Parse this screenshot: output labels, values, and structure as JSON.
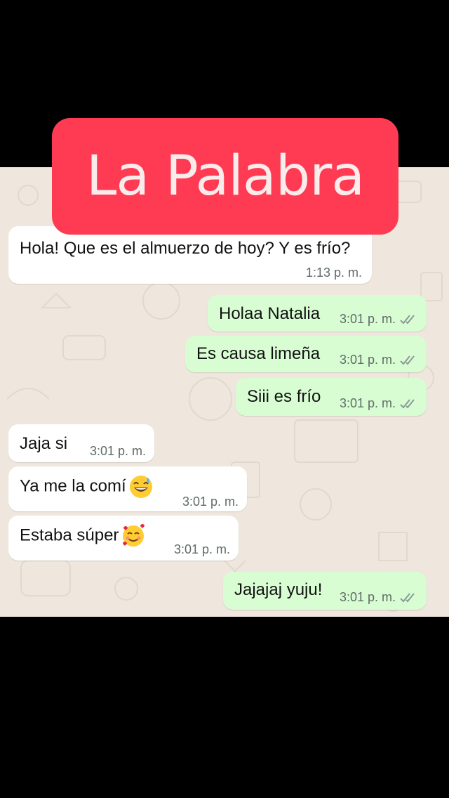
{
  "title": "La Palabra",
  "messages": [
    {
      "direction": "incoming",
      "text": "Hola! Que es el almuerzo de hoy? Y es frío?",
      "time": "1:13 p. m."
    },
    {
      "direction": "outgoing",
      "text": "Holaa Natalia",
      "time": "3:01 p. m.",
      "status_icon": "double-check-icon"
    },
    {
      "direction": "outgoing",
      "text": "Es causa limeña",
      "time": "3:01 p. m.",
      "status_icon": "double-check-icon"
    },
    {
      "direction": "outgoing",
      "text": "Siii es frío",
      "time": "3:01 p. m.",
      "status_icon": "double-check-icon"
    },
    {
      "direction": "incoming",
      "text": "Jaja si",
      "time": "3:01 p. m."
    },
    {
      "direction": "incoming",
      "text": "Ya me la comí",
      "time": "3:01 p. m.",
      "emoji": "grinning-sweat-emoji"
    },
    {
      "direction": "incoming",
      "text": "Estaba súper",
      "time": "3:01 p. m.",
      "emoji": "smiling-face-with-hearts-emoji"
    },
    {
      "direction": "outgoing",
      "text": "Jajajaj yuju!",
      "time": "3:01 p. m.",
      "status_icon": "double-check-icon"
    }
  ],
  "colors": {
    "banner": "#ff3b54",
    "banner_text": "#fbecec",
    "chat_background": "#efe7dd",
    "incoming_bubble": "#ffffff",
    "outgoing_bubble": "#d9fdd3",
    "read_check": "#8a9a94"
  }
}
